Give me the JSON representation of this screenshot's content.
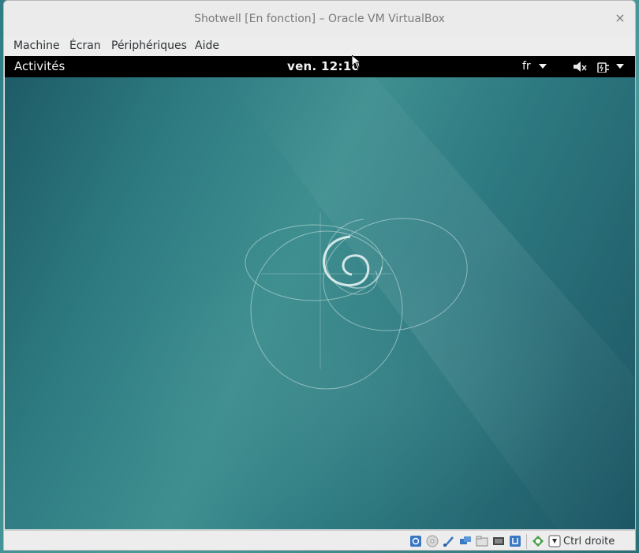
{
  "window": {
    "title": "Shotwell [En fonction] – Oracle VM VirtualBox",
    "close_glyph": "×"
  },
  "menubar": {
    "items": [
      "Machine",
      "Écran",
      "Périphériques",
      "Aide"
    ]
  },
  "guest": {
    "topbar": {
      "activities": "Activités",
      "clock": "ven. 12:10",
      "language": "fr",
      "tray_icons": [
        "volume-muted-icon",
        "power-menu-icon"
      ]
    },
    "wallpaper": "debian-swirl-wallpaper"
  },
  "statusbar": {
    "icons": [
      "hard-disk-icon",
      "optical-drive-icon",
      "usb-icon",
      "network-icon",
      "shared-folder-icon",
      "display-icon",
      "video-capture-icon",
      "mouse-integration-icon",
      "keyboard-capture-icon"
    ],
    "host_key_label": "Ctrl droite"
  },
  "colors": {
    "topbar": "#000000",
    "wallpaper_accent": "#2f7d83",
    "chrome": "#ededed"
  }
}
